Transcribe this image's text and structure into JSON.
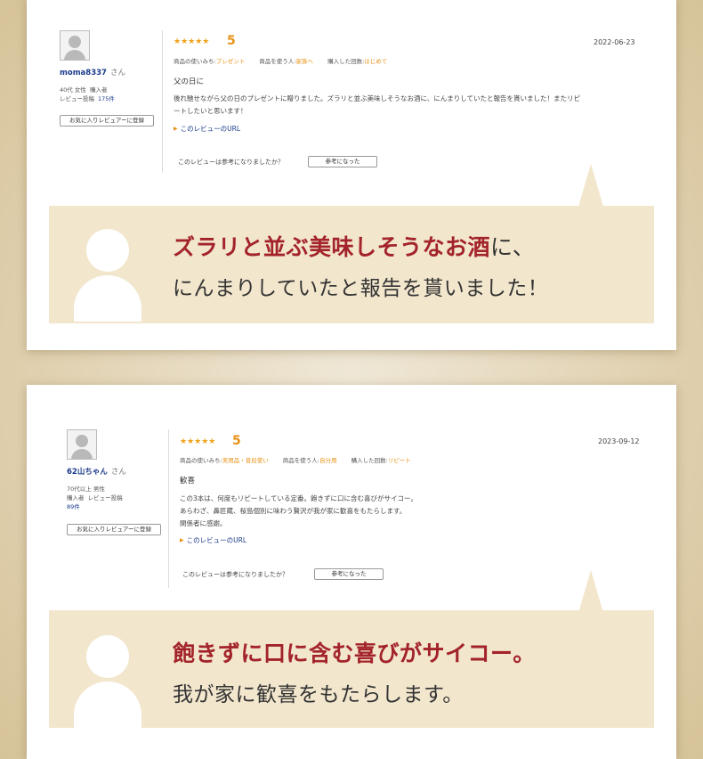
{
  "reviews": [
    {
      "username": "moma8337",
      "honorific": "さん",
      "age_gender": "40代 女性",
      "buyer": "購入者",
      "review_count_label": "レビュー投稿",
      "review_count": "175件",
      "fav_button": "お気に入りレビュアーに登録",
      "stars": "★★★★★",
      "score": "5",
      "date": "2022-06-23",
      "usage_label": "商品の使いみち:",
      "usage_value": "プレゼント",
      "user_label": "商品を使う人:",
      "user_value": "家族へ",
      "times_label": "購入した回数:",
      "times_value": "はじめて",
      "title": "父の日に",
      "body_lines": [
        "後れ馳せながら父の日のプレゼントに贈りました。ズラリと並ぶ美味しそうなお酒に、にんまりしていたと報告を貰いました！またリピ",
        "ートしたいと思います！"
      ],
      "review_url": "このレビューのURL",
      "helpful_question": "このレビューは参考になりましたか？",
      "helpful_button": "参考になった"
    },
    {
      "username": "62山ちゃん",
      "honorific": "さん",
      "age_gender": "70代以上 男性",
      "buyer": "購入者",
      "review_count_label": "レビュー投稿",
      "review_count": "89件",
      "fav_button": "お気に入りレビュアーに登録",
      "stars": "★★★★★",
      "score": "5",
      "date": "2023-09-12",
      "usage_label": "商品の使いみち:",
      "usage_value": "実用品・普段使い",
      "user_label": "商品を使う人:",
      "user_value": "自分用",
      "times_label": "購入した回数:",
      "times_value": "リピート",
      "title": "歓喜",
      "body_lines": [
        "この3本は、何度もリピートしている定番。飽きずに口に含む喜びがサイコー。",
        "あらわざ、鼻匠蔵、桜島個別に味わう贅沢が我が家に歓喜をもたらします。",
        "関係者に感謝。"
      ],
      "review_url": "このレビューのURL",
      "helpful_question": "このレビューは参考になりましたか？",
      "helpful_button": "参考になった"
    }
  ],
  "callouts": [
    {
      "highlight": "ズラリと並ぶ美味しそうなお酒",
      "highlight_tail": "に、",
      "line2": "にんまりしていたと報告を貰いました！"
    },
    {
      "highlight": "飽きずに口に含む喜びがサイコー。",
      "line2": "我が家に歓喜をもたらします。"
    }
  ],
  "colors": {
    "accent_red": "#a3232a",
    "star_orange": "#f0a21a",
    "bubble_beige": "#f2e6cd",
    "link_blue": "#1a3a8a"
  }
}
